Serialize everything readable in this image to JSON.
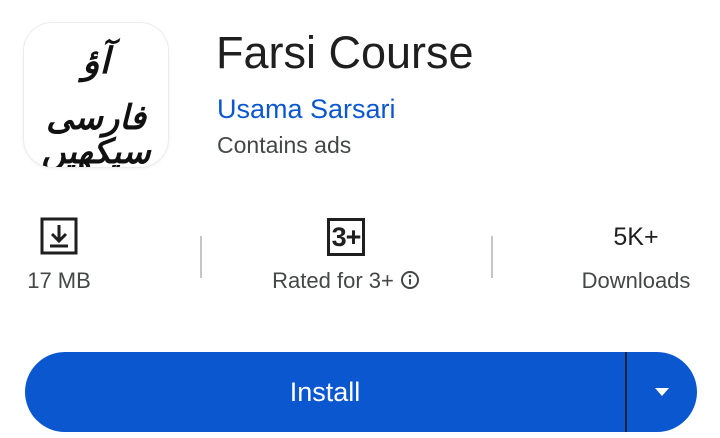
{
  "app": {
    "title": "Farsi Course",
    "developer": "Usama Sarsari",
    "ads_notice": "Contains ads",
    "icon_text_line1": "آؤ",
    "icon_text_line2": "فارسی سیکھیں"
  },
  "stats": {
    "size": {
      "icon": "download-icon",
      "label": "17 MB"
    },
    "rating": {
      "badge": "3+",
      "label": "Rated for 3+",
      "info_icon": "info-icon"
    },
    "downloads": {
      "value": "5K+",
      "label": "Downloads"
    }
  },
  "actions": {
    "install_label": "Install",
    "dropdown_icon": "caret-down-icon"
  },
  "colors": {
    "accent": "#0b57d0",
    "text_primary": "#1f1f1f",
    "text_secondary": "#444746"
  }
}
